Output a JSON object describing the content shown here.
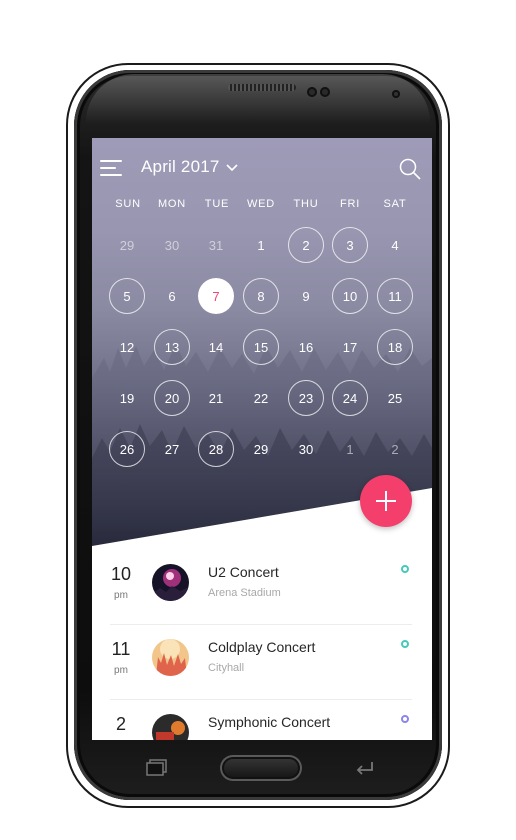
{
  "calendar": {
    "month_title": "April 2017",
    "weekdays": [
      "SUN",
      "MON",
      "TUE",
      "WED",
      "THU",
      "FRI",
      "SAT"
    ],
    "weeks": [
      [
        "29",
        "30",
        "31",
        "1",
        "2",
        "3",
        "4"
      ],
      [
        "5",
        "6",
        "7",
        "8",
        "9",
        "10",
        "11"
      ],
      [
        "12",
        "13",
        "14",
        "15",
        "16",
        "17",
        "18"
      ],
      [
        "19",
        "20",
        "21",
        "22",
        "23",
        "24",
        "25"
      ],
      [
        "26",
        "27",
        "28",
        "29",
        "30",
        "1",
        "2"
      ]
    ],
    "today": "7",
    "accent_color": "#f43f6d"
  },
  "icons": {
    "menu": "menu-icon",
    "dropdown": "chevron-down-icon",
    "search": "search-icon",
    "add": "plus-icon"
  },
  "events": [
    {
      "time": "10",
      "ampm": "pm",
      "title": "U2 Concert",
      "place": "Arena Stadium",
      "dot_color": "#46c9bb"
    },
    {
      "time": "11",
      "ampm": "pm",
      "title": "Coldplay Concert",
      "place": "Cityhall",
      "dot_color": "#46c9bb"
    },
    {
      "time": "2",
      "ampm": "",
      "title": "Symphonic Concert",
      "place": "",
      "dot_color": "#8b85ea"
    }
  ]
}
